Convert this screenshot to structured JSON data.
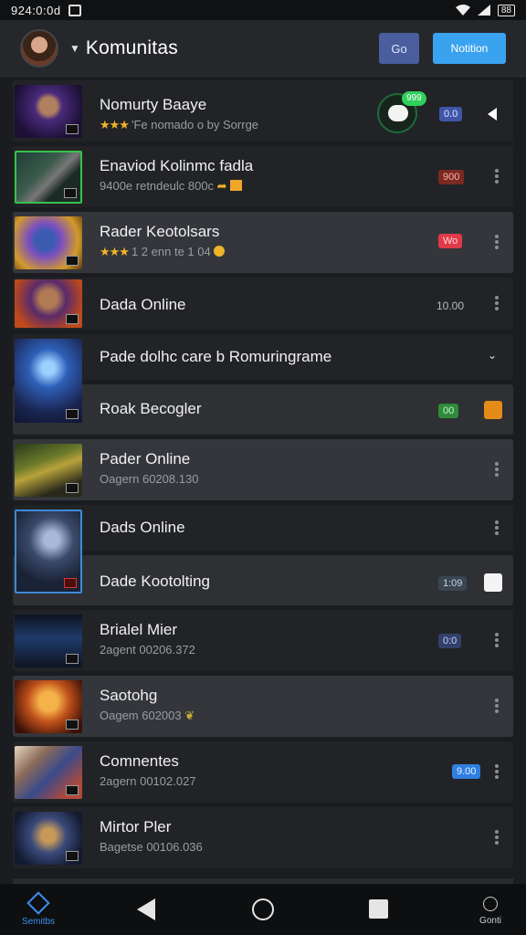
{
  "status_bar": {
    "time": "924:0:0d",
    "battery": "88"
  },
  "header": {
    "title": "Komunitas",
    "button1": "Go",
    "button2": "Notition"
  },
  "list": [
    {
      "title": "Nomurty Baaye",
      "stars": "★★★",
      "sub": "'Fe nomado o by Sorrge",
      "chat_count": "999",
      "pill": "0.0"
    },
    {
      "title": "Enaviod Kolinmc fadla",
      "sub": "9400e retndeulc 800c",
      "pill": "900"
    },
    {
      "title": "Rader Keotolsars",
      "stars": "★★★",
      "sub": "1 2 enn te 1 04",
      "pill": "Wo"
    },
    {
      "title": "Dada Online",
      "value": "10.00"
    },
    {
      "title": "Pade dolhc care b Romuringrame"
    },
    {
      "title": "Roak Becogler",
      "pill": "00"
    },
    {
      "title": "Pader Online",
      "sub": "Oagern 60208.130"
    },
    {
      "title": "Dads Online"
    },
    {
      "title": "Dade Kootolting",
      "pill": "1:09"
    },
    {
      "title": "Brialel Mier",
      "sub": "2agent 00206.372",
      "pill": "0:0"
    },
    {
      "title": "Saotohg",
      "sub": "Oagem 602003"
    },
    {
      "title": "Comnentes",
      "sub": "2agern 00102.027",
      "pill": "9.00"
    },
    {
      "title": "Mirtor Pler",
      "sub": "Bagetse 00106.036"
    }
  ],
  "bottom_nav": {
    "left_label": "Semitbs",
    "right_label": "Gonti"
  },
  "colors": {
    "accent_blue": "#3aa3ef",
    "nav_active": "#3b8ef0",
    "chat_green": "#2fcf5a"
  }
}
